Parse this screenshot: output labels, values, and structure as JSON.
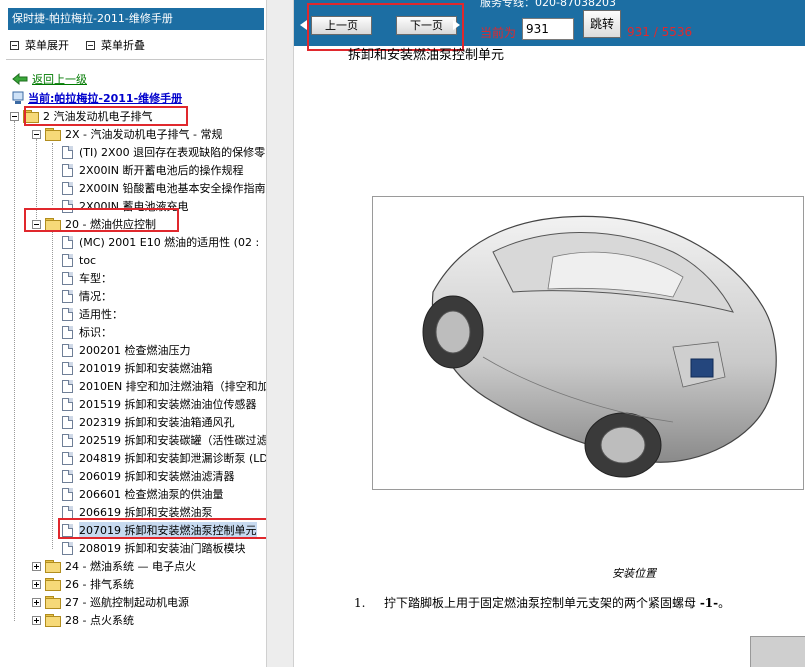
{
  "left_panel": {
    "title": "保时捷-帕拉梅拉-2011-维修手册",
    "expand_label": "菜单展开",
    "collapse_label": "菜单折叠",
    "back_label": "返回上一级",
    "current_label": "当前:帕拉梅拉-2011-维修手册"
  },
  "tree": {
    "root": "2 汽油发动机电子排气",
    "group1": "2X - 汽油发动机电子排气 - 常规",
    "group1_items": [
      "(TI) 2X00 退回存在表观缺陷的保修零",
      "2X00IN 断开蓄电池后的操作规程",
      "2X00IN 铅酸蓄电池基本安全操作指南",
      "2X00IN 蓄电池液充电"
    ],
    "group2": "20 - 燃油供应控制",
    "group2_items": [
      "(MC) 2001 E10 燃油的适用性 (02 :",
      "toc",
      "车型：",
      "情况：",
      "适用性：",
      "标识：",
      "200201 检查燃油压力",
      "201019 拆卸和安装燃油箱",
      "2010EN 排空和加注燃油箱（排空和加",
      "201519 拆卸和安装燃油油位传感器",
      "202319 拆卸和安装油箱通风孔",
      "202519 拆卸和安装碳罐（活性碳过滤",
      "204819 拆卸和安装卸泄漏诊断泵 (LD",
      "206019 拆卸和安装燃油滤清器",
      "206601 检查燃油泵的供油量",
      "206619 拆卸和安装燃油泵",
      "207019 拆卸和安装燃油泵控制单元",
      "208019 拆卸和安装油门踏板模块"
    ],
    "collapsed_groups": [
      "24 - 燃油系统 — 电子点火",
      "26 - 排气系统",
      "27 - 巡航控制起动机电源",
      "28 - 点火系统"
    ]
  },
  "toolbar": {
    "phone_text": "服务专线：020-87038203",
    "prev_label": "上一页",
    "next_label": "下一页",
    "current_page_label": "当前为",
    "page_value": "931",
    "go_label": "跳转",
    "page_count": "931 / 5536"
  },
  "content": {
    "title": "拆卸和安装燃油泵控制单元",
    "figure_caption": "安装位置",
    "step_number": "1.",
    "step_text": "拧下踏脚板上用于固定燃油泵控制单元支架的两个紧固螺母 ",
    "step_ref": "-1-",
    "step_tail": "。"
  },
  "colors": {
    "header_blue": "#1c6ea3",
    "annotation_red": "#e0282d",
    "selection_blue": "#c7daf0"
  }
}
